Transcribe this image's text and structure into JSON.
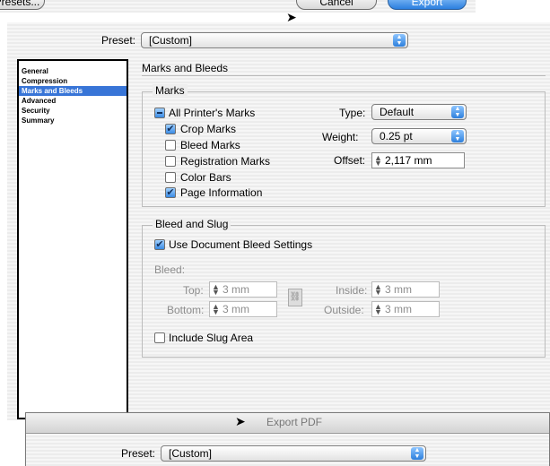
{
  "top_fragment": {
    "presets_button": "Presets...",
    "cancel_button": "Cancel",
    "export_button": "Export"
  },
  "dialog": {
    "preset_label": "Preset:",
    "preset_value": "[Custom]",
    "sidebar": {
      "items": [
        {
          "label": "General",
          "selected": false
        },
        {
          "label": "Compression",
          "selected": false
        },
        {
          "label": "Marks and Bleeds",
          "selected": true
        },
        {
          "label": "Advanced",
          "selected": false
        },
        {
          "label": "Security",
          "selected": false
        },
        {
          "label": "Summary",
          "selected": false
        }
      ]
    },
    "section_title": "Marks and Bleeds",
    "marks": {
      "group_title": "Marks",
      "all_printers_marks": {
        "label": "All Printer's Marks",
        "state": "mixed"
      },
      "crop_marks": {
        "label": "Crop Marks",
        "checked": true
      },
      "bleed_marks": {
        "label": "Bleed Marks",
        "checked": false
      },
      "registration_marks": {
        "label": "Registration Marks",
        "checked": false
      },
      "color_bars": {
        "label": "Color Bars",
        "checked": false
      },
      "page_information": {
        "label": "Page Information",
        "checked": true
      },
      "type_label": "Type:",
      "type_value": "Default",
      "weight_label": "Weight:",
      "weight_value": "0.25 pt",
      "offset_label": "Offset:",
      "offset_value": "2,117 mm"
    },
    "bleed_slug": {
      "group_title": "Bleed and Slug",
      "use_document_bleed": {
        "label": "Use Document Bleed Settings",
        "checked": true
      },
      "bleed_label": "Bleed:",
      "top_label": "Top:",
      "top_value": "3 mm",
      "bottom_label": "Bottom:",
      "bottom_value": "3 mm",
      "inside_label": "Inside:",
      "inside_value": "3 mm",
      "outside_label": "Outside:",
      "outside_value": "3 mm",
      "include_slug": {
        "label": "Include Slug Area",
        "checked": false
      }
    }
  },
  "second_window": {
    "title": "Export PDF",
    "preset_label": "Preset:",
    "preset_value": "[Custom]"
  },
  "colors": {
    "accent": "#3875d7",
    "window_bg": "#eeeeee"
  }
}
